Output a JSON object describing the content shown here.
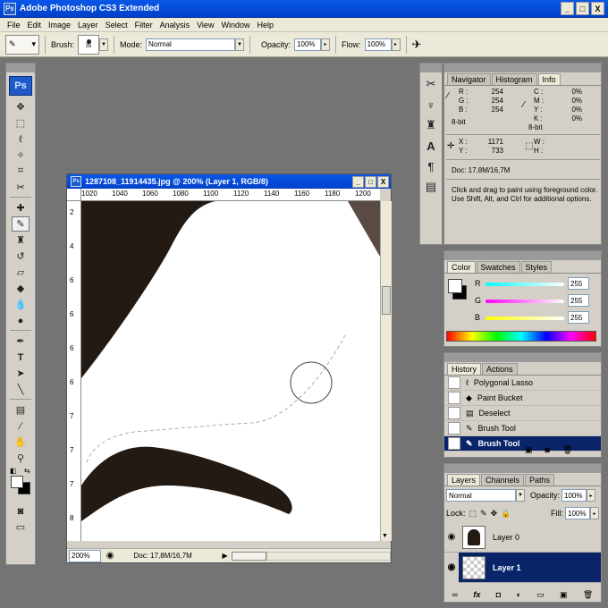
{
  "app": {
    "title": "Adobe Photoshop CS3 Extended",
    "logo": "Ps"
  },
  "window_buttons": [
    "_",
    "□",
    "X"
  ],
  "menu": [
    "File",
    "Edit",
    "Image",
    "Layer",
    "Select",
    "Filter",
    "Analysis",
    "View",
    "Window",
    "Help"
  ],
  "options": {
    "brush_label": "Brush:",
    "brush_size": "35",
    "mode_label": "Mode:",
    "mode_value": "Normal",
    "opacity_label": "Opacity:",
    "opacity_value": "100%",
    "flow_label": "Flow:",
    "flow_value": "100%"
  },
  "document": {
    "title": "1287108_11914435.jpg @ 200% (Layer 1, RGB/8)",
    "ruler_h": [
      "1020",
      "1040",
      "1060",
      "1080",
      "1100",
      "1120",
      "1140",
      "1160",
      "1180",
      "1200"
    ],
    "ruler_v": [
      "2",
      "4",
      "6",
      "6",
      "6",
      "6",
      "7",
      "7",
      "7",
      "8"
    ],
    "zoom": "200%",
    "doc_info": "Doc: 17,8M/16,7M"
  },
  "info_panel": {
    "tabs": [
      "Navigator",
      "Histogram",
      "Info"
    ],
    "rgb_labels": [
      "R :",
      "G :",
      "B :"
    ],
    "rgb_values": [
      "254",
      "254",
      "254"
    ],
    "bit_left": "8-bit",
    "cmyk_labels": [
      "C :",
      "M :",
      "Y :",
      "K :"
    ],
    "cmyk_values": [
      "0%",
      "0%",
      "0%",
      "0%"
    ],
    "bit_right": "8-bit",
    "x_label": "X :",
    "x_value": "1171",
    "y_label": "Y :",
    "y_value": "733",
    "w_label": "W :",
    "h_label": "H :",
    "doc": "Doc: 17,8M/16,7M",
    "hint": "Click and drag to paint using foreground color. Use Shift, Alt, and Ctrl for additional options."
  },
  "color_panel": {
    "tabs": [
      "Color",
      "Swatches",
      "Styles"
    ],
    "channels": [
      {
        "label": "R",
        "value": "255"
      },
      {
        "label": "G",
        "value": "255"
      },
      {
        "label": "B",
        "value": "255"
      }
    ]
  },
  "history_panel": {
    "tabs": [
      "History",
      "Actions"
    ],
    "items": [
      "Polygonal Lasso",
      "Paint Bucket",
      "Deselect",
      "Brush Tool",
      "Brush Tool"
    ]
  },
  "layers_panel": {
    "tabs": [
      "Layers",
      "Channels",
      "Paths"
    ],
    "blend": "Normal",
    "opacity_label": "Opacity:",
    "opacity_value": "100%",
    "lock_label": "Lock:",
    "fill_label": "Fill:",
    "fill_value": "100%",
    "layers": [
      "Layer 0",
      "Layer 1"
    ]
  },
  "colors": {
    "title_blue": "#0a58e8",
    "selection": "#0a246a",
    "canvas_dark": "#231a14"
  }
}
